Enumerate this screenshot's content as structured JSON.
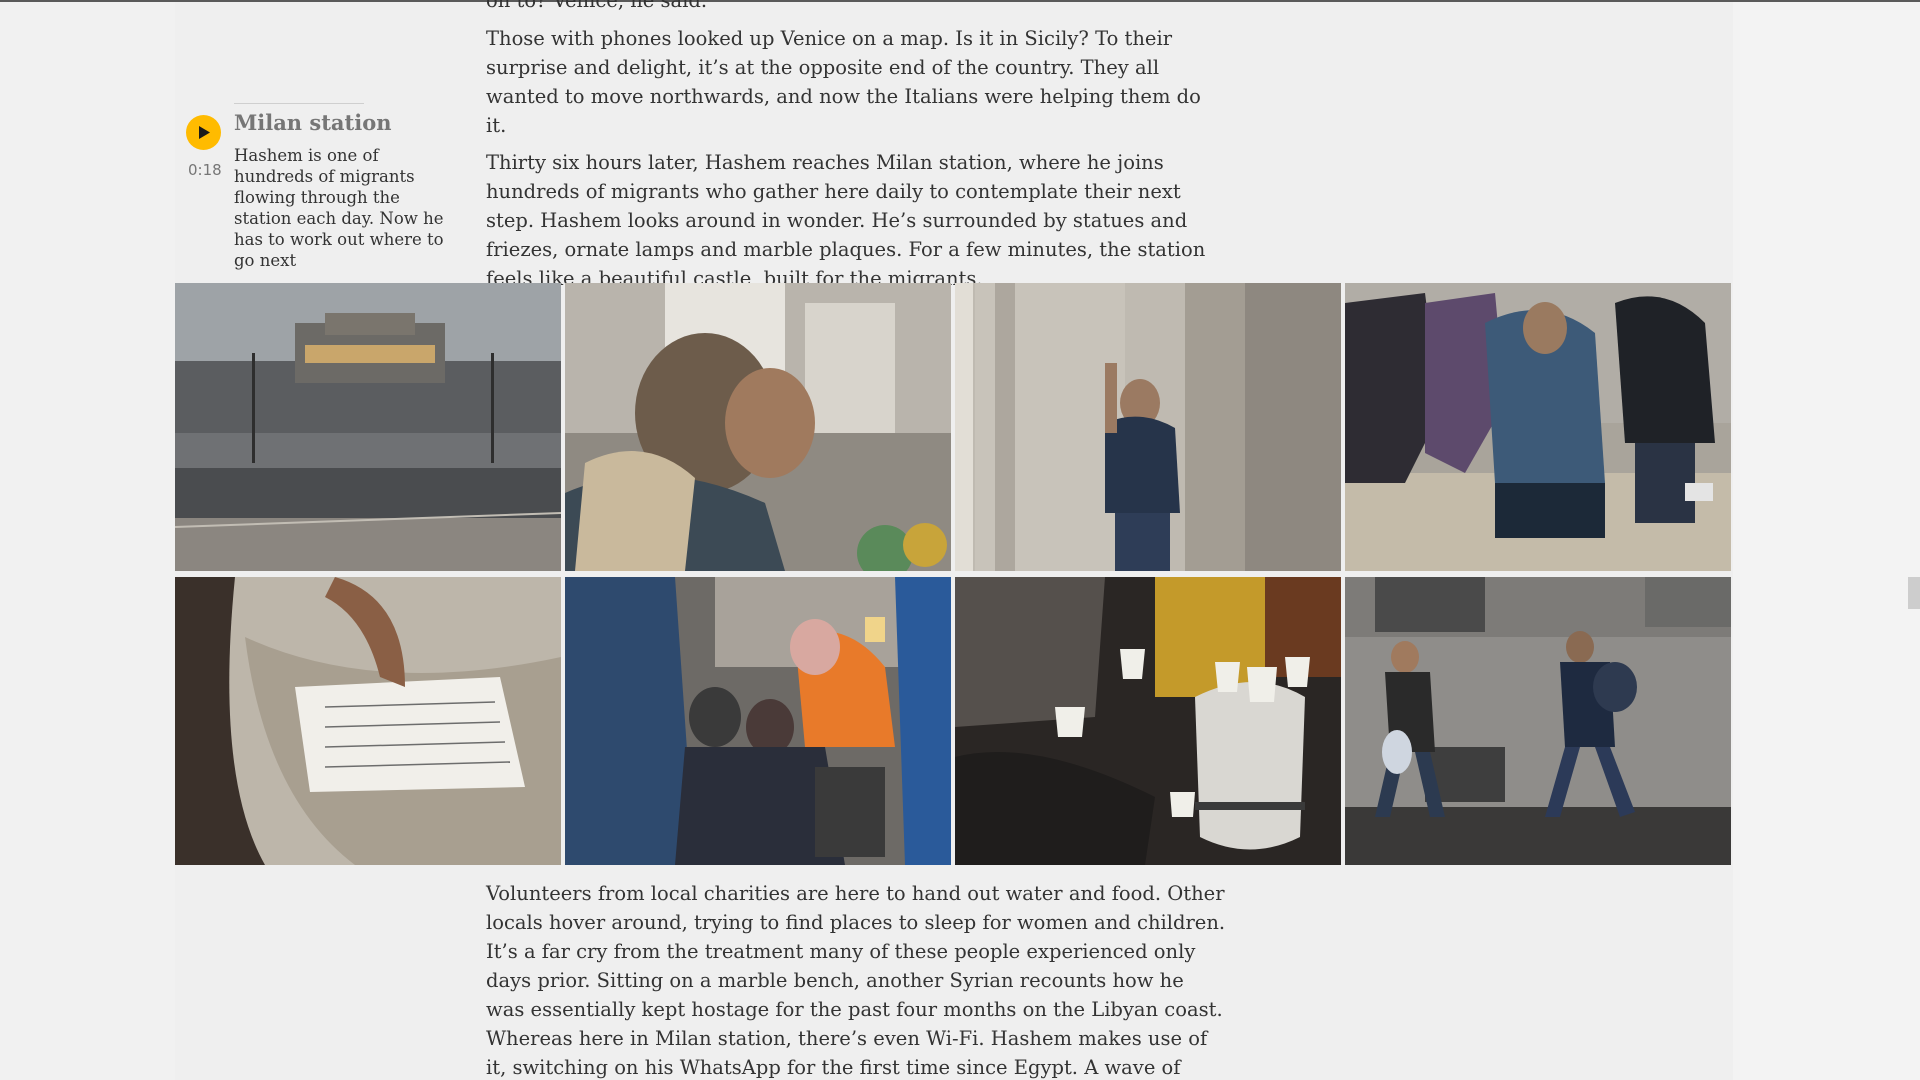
{
  "article": {
    "cut_line": "on to? Venice, he said.",
    "paragraphs_top": [
      "Those with phones looked up Venice on a map. Is it in Sicily? To their surprise and delight, it’s at the opposite end of the country. They all wanted to move northwards, and now the Italians were helping them do it.",
      "Thirty six hours later, Hashem reaches Milan station, where he joins hundreds of migrants who gather here daily to contemplate their next step. Hashem looks around in wonder. He’s surrounded by statues and friezes, ornate lamps and marble plaques. For a few minutes, the station feels like a beautiful castle, built for the migrants."
    ],
    "paragraphs_bottom": [
      "Volunteers from local charities are here to hand out water and food. Other locals hover around, trying to find places to sleep for women and children. It’s a far cry from the treatment many of these people experienced only days prior. Sitting on a marble bench, another Syrian recounts how he was essentially kept hostage for the past four months on the Libyan coast. Whereas here in Milan station, there’s even Wi-Fi. Hashem makes use of it, switching on his WhatsApp for the first time since Egypt. A wave of unread messages floods his inbox."
    ]
  },
  "audio": {
    "title": "Milan station",
    "duration": "0:18",
    "caption": "Hashem is one of hundreds of migrants flowing through the station each day. Now he has to work out where to go next",
    "icon": "play-icon",
    "accent_color": "#ffbb00"
  },
  "photos": [
    {
      "subject": "milan-station-exterior"
    },
    {
      "subject": "man-covering-face"
    },
    {
      "subject": "man-leaning-on-column"
    },
    {
      "subject": "men-sitting-on-bench"
    },
    {
      "subject": "handwritten-note"
    },
    {
      "subject": "volunteer-with-children"
    },
    {
      "subject": "cups-of-tea"
    },
    {
      "subject": "men-walking-in-street"
    }
  ]
}
